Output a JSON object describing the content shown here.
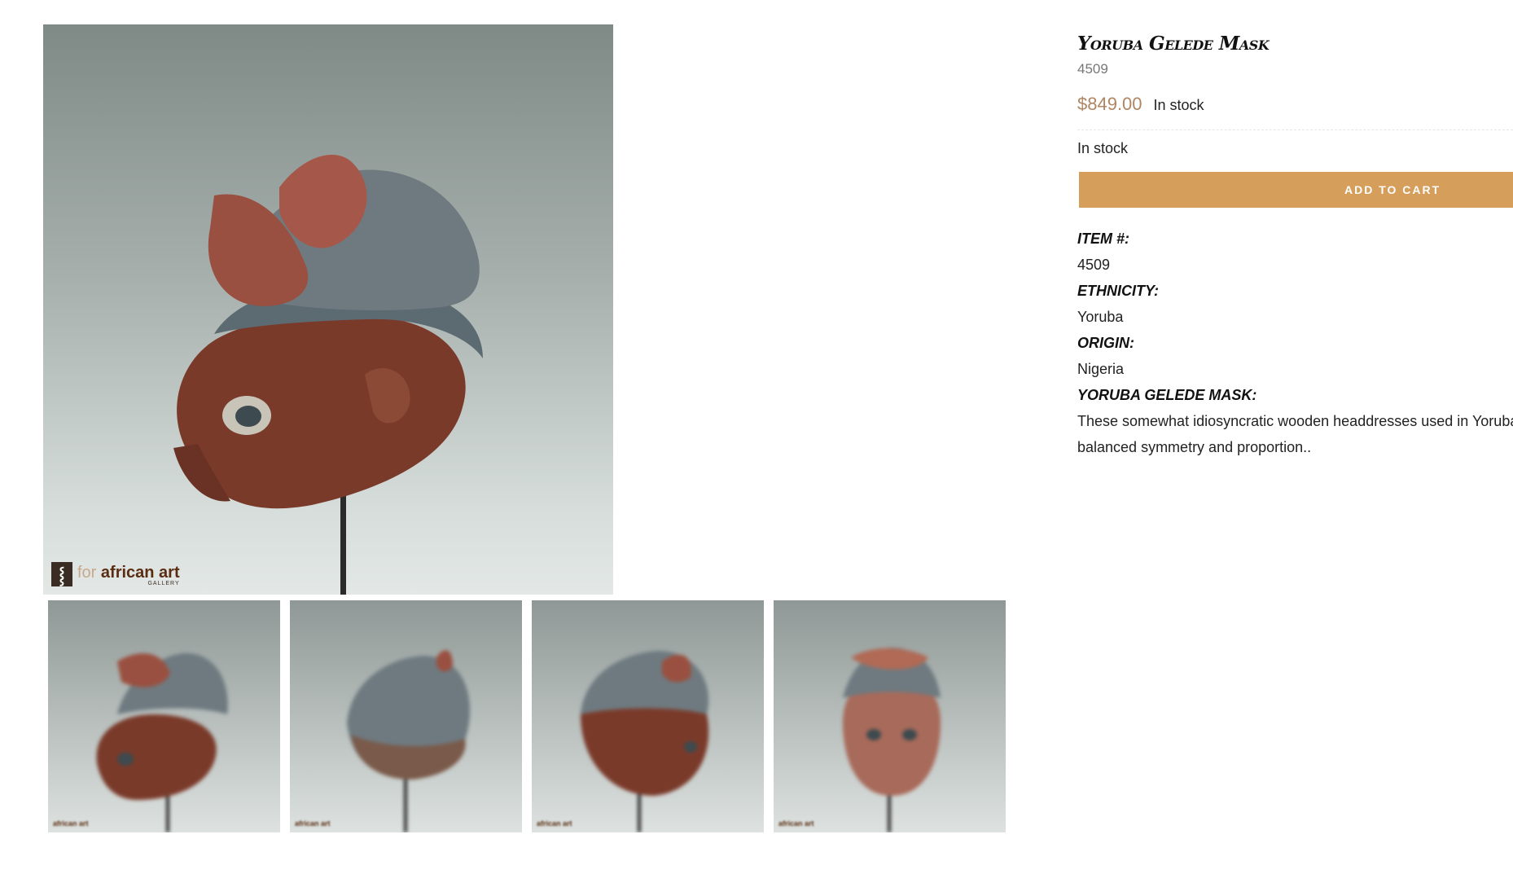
{
  "gallery": {
    "main_image_alt": "Yoruba Gelede Mask",
    "watermark": {
      "for": "for",
      "brand": "african art",
      "sub": "GALLERY"
    },
    "thumbnails": [
      {
        "alt": "Yoruba Gelede Mask view 1",
        "watermark": "african art"
      },
      {
        "alt": "Yoruba Gelede Mask view 2",
        "watermark": "african art"
      },
      {
        "alt": "Yoruba Gelede Mask view 3",
        "watermark": "african art"
      },
      {
        "alt": "Yoruba Gelede Mask view 4",
        "watermark": "african art"
      }
    ]
  },
  "product": {
    "title": "Yoruba Gelede Mask",
    "sku": "4509",
    "price": "$849.00",
    "stock_inline": "In stock",
    "stock_line": "In stock",
    "add_to_cart": "ADD TO CART",
    "specs": [
      {
        "label": "ITEM #:",
        "value": "4509"
      },
      {
        "label": "ETHNICITY:",
        "value": "Yoruba"
      },
      {
        "label": "ORIGIN:",
        "value": "Nigeria"
      }
    ],
    "description_label": "YORUBA GELEDE MASK:",
    "description_line1": "These somewhat idiosyncratic wooden headdresses used in Yoruba",
    "description_line2": "balanced symmetry and proportion.."
  },
  "colors": {
    "price": "#b08562",
    "button": "#d69e5b"
  }
}
